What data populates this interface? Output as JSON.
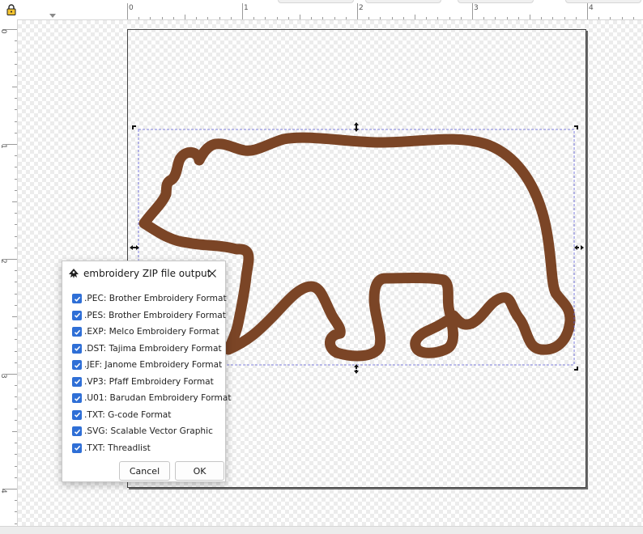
{
  "ruler": {
    "top_numbers": [
      "0",
      "1",
      "2",
      "3",
      "4"
    ],
    "left_numbers": [
      "0",
      "1",
      "2",
      "3",
      "4"
    ]
  },
  "colors": {
    "bear_outline": "#7b4526",
    "selection_box": "#5a5ad6",
    "checkbox": "#2f6fd6"
  },
  "icons": {
    "lock": "lock-icon",
    "app": "inkscape-icon",
    "close": "close-icon",
    "check": "checkmark-icon"
  },
  "dialog": {
    "title": "embroidery ZIP file output",
    "formats": [
      ".PEC: Brother Embroidery Format",
      ".PES: Brother Embroidery Format",
      ".EXP: Melco Embroidery Format",
      ".DST: Tajima Embroidery Format",
      ".JEF: Janome Embroidery Format",
      ".VP3: Pfaff Embroidery Format",
      ".U01: Barudan Embroidery Format",
      ".TXT: G-code Format",
      ".SVG: Scalable Vector Graphic",
      ".TXT: Threadlist"
    ],
    "cancel_label": "Cancel",
    "ok_label": "OK"
  }
}
